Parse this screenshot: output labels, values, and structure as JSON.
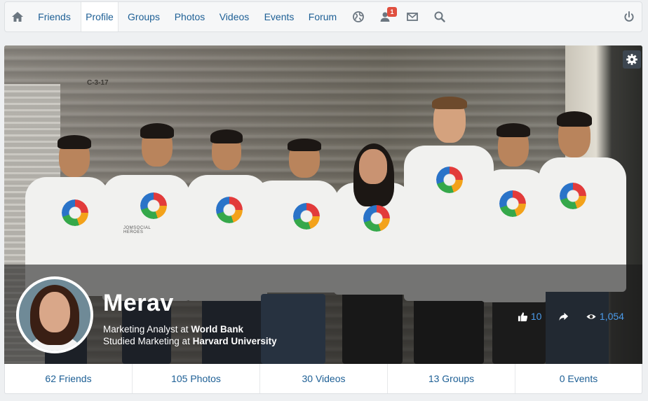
{
  "nav": {
    "items": [
      {
        "label": "Friends"
      },
      {
        "label": "Profile",
        "active": true
      },
      {
        "label": "Groups"
      },
      {
        "label": "Photos"
      },
      {
        "label": "Videos"
      },
      {
        "label": "Events"
      },
      {
        "label": "Forum"
      }
    ],
    "icons": [
      "home-icon",
      "globe-icon",
      "friend-requests-icon",
      "mail-icon",
      "search-icon",
      "power-icon"
    ],
    "notification_badge": "1"
  },
  "cover": {
    "sign_text": "C-3-17",
    "shirt_text": "JOMSOCIAL HEROES"
  },
  "profile": {
    "name": "Merav",
    "line1_prefix": "Marketing Analyst at ",
    "line1_strong": "World Bank",
    "line2_prefix": "Studied Marketing at ",
    "line2_strong": "Harvard University"
  },
  "stats": {
    "likes": "10",
    "views": "1,054"
  },
  "tabs": [
    {
      "label": "62 Friends"
    },
    {
      "label": "105 Photos"
    },
    {
      "label": "30 Videos"
    },
    {
      "label": "13 Groups"
    },
    {
      "label": "0 Events"
    }
  ],
  "colors": {
    "link": "#1d5f95",
    "stat": "#4b9bea",
    "badge": "#e04f3f"
  }
}
